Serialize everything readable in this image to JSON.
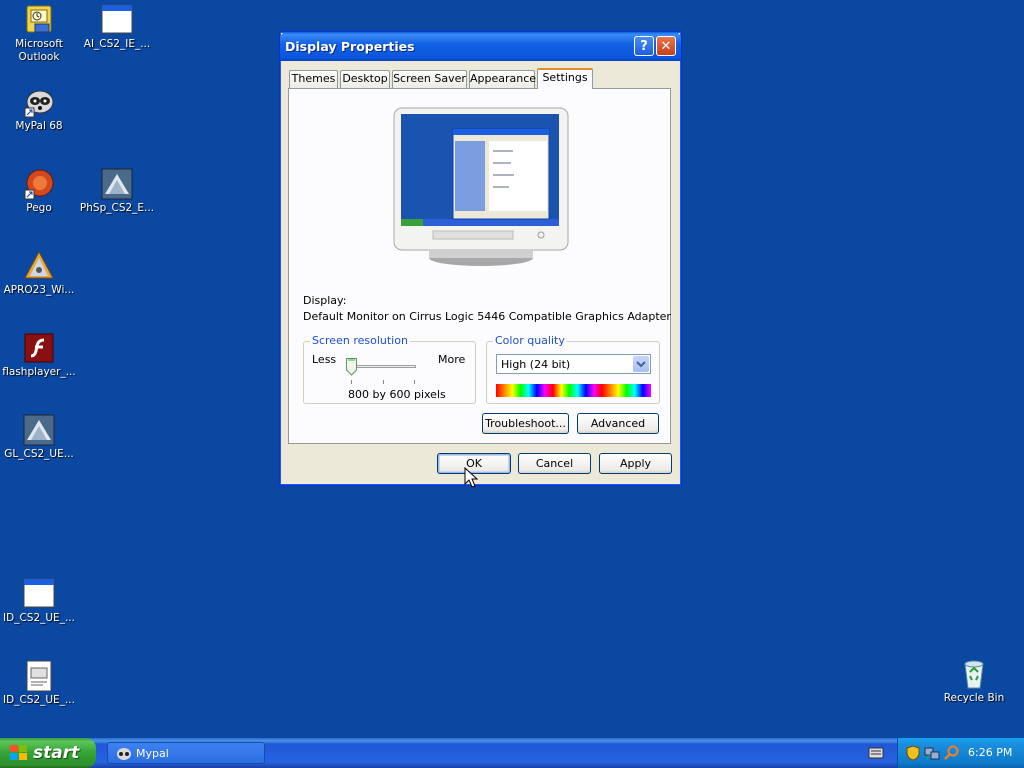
{
  "desktop": {
    "icons": [
      {
        "label": "Microsoft\nOutlook",
        "icon": "outlook-icon"
      },
      {
        "label": "AI_CS2_IE_...",
        "icon": "window-icon"
      },
      {
        "label": "MyPal 68",
        "icon": "mypal-icon"
      },
      {
        "label": "Pego",
        "icon": "pego-icon"
      },
      {
        "label": "PhSp_CS2_E...",
        "icon": "installer-icon"
      },
      {
        "label": "APRO23_Wi...",
        "icon": "acrobat-icon"
      },
      {
        "label": "flashplayer_...",
        "icon": "flash-icon"
      },
      {
        "label": "GL_CS2_UE...",
        "icon": "installer-icon"
      },
      {
        "label": "ID_CS2_UE_...",
        "icon": "window-icon"
      },
      {
        "label": "ID_CS2_UE_...",
        "icon": "document-icon"
      },
      {
        "label": "Recycle Bin",
        "icon": "recycle-bin-icon"
      }
    ]
  },
  "dialog": {
    "title": "Display Properties",
    "tabs": [
      "Themes",
      "Desktop",
      "Screen Saver",
      "Appearance",
      "Settings"
    ],
    "active_tab": "Settings",
    "display_label": "Display:",
    "display_value": "Default Monitor on Cirrus Logic 5446 Compatible Graphics Adapter",
    "resolution": {
      "title": "Screen resolution",
      "less": "Less",
      "more": "More",
      "value": "800 by 600 pixels"
    },
    "color": {
      "title": "Color quality",
      "selected": "High (24 bit)"
    },
    "buttons": {
      "troubleshoot": "Troubleshoot...",
      "advanced": "Advanced",
      "ok": "OK",
      "cancel": "Cancel",
      "apply": "Apply"
    }
  },
  "taskbar": {
    "start_label": "start",
    "task": "Mypal",
    "clock": "6:26 PM"
  },
  "colors": {
    "desktop": "#0b48a1",
    "titlebar": "#0a5fe0",
    "accent": "#e68b2c"
  }
}
